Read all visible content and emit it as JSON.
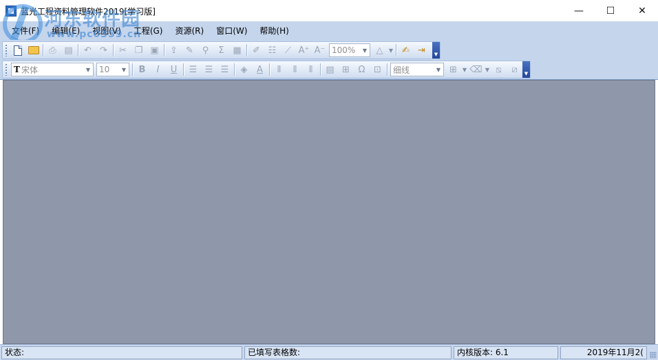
{
  "window": {
    "title": "蓝光工程资料管理软件2019[学习版]",
    "minimize_glyph": "—",
    "maximize_glyph": "☐",
    "close_glyph": "✕"
  },
  "watermark": {
    "main": "河东软件园",
    "sub": "www.pc0359.cn"
  },
  "menu": [
    {
      "label": "文件(F)"
    },
    {
      "label": "编辑(E)"
    },
    {
      "label": "视图(V)"
    },
    {
      "label": "工程(G)"
    },
    {
      "label": "资源(R)"
    },
    {
      "label": "窗口(W)"
    },
    {
      "label": "帮助(H)"
    }
  ],
  "toolbar1": {
    "zoom_value": "100%",
    "icons": [
      "new-icon",
      "open-icon",
      "print-preview-icon",
      "print-icon",
      "undo-icon",
      "redo-icon",
      "cut-icon",
      "copy-icon",
      "paste-icon",
      "export-icon",
      "brush-icon",
      "find-icon",
      "sum-icon",
      "calc-icon",
      "pen-icon",
      "form-icon",
      "chart-icon",
      "font-grow-icon",
      "font-shrink-icon",
      "triangle-icon",
      "tools-icon",
      "exit-icon"
    ]
  },
  "toolbar2": {
    "font_prefix": "T",
    "font_name": "宋体",
    "font_size": "10",
    "line_style": "细线",
    "glyphs": {
      "bold": "B",
      "italic": "I",
      "underline": "U",
      "omega": "Ω",
      "font_color": "A",
      "zoom_grow": "A⁺",
      "zoom_shrink": "A⁻",
      "sum": "Σ",
      "find": "🔍",
      "triangle": "△"
    }
  },
  "status": {
    "state_label": "状态:",
    "filled_forms_label": "已填写表格数:",
    "kernel_version": "内核版本: 6.1",
    "date": "2019年11月2("
  },
  "colors": {
    "client_bg": "#8f97aa",
    "menubar_bg": "#c4d5ec",
    "statusbar_bg": "#c9d8ee"
  }
}
